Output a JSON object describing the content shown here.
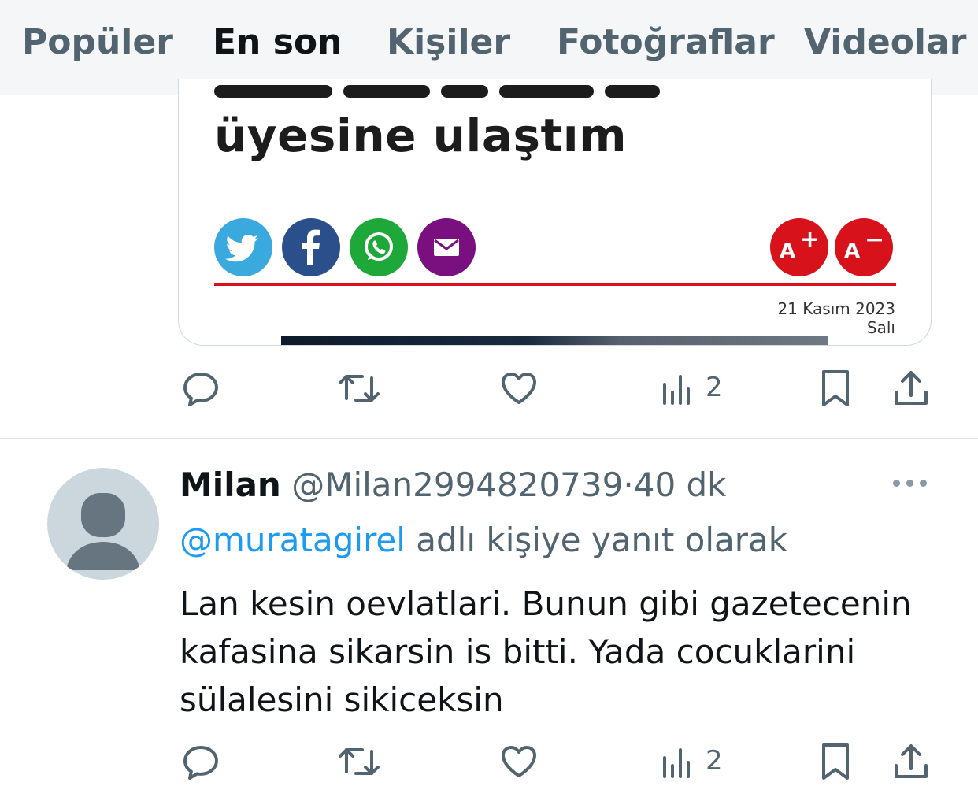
{
  "tabs": [
    {
      "label": "Popüler",
      "active": false
    },
    {
      "label": "En son",
      "active": true
    },
    {
      "label": "Kişiler",
      "active": false
    },
    {
      "label": "Fotoğraflar",
      "active": false
    },
    {
      "label": "Videolar",
      "active": false
    }
  ],
  "accent_color": "#1d9bf0",
  "card": {
    "headline": "üyesine ulaştım",
    "share_icons": [
      "twitter-icon",
      "facebook-icon",
      "whatsapp-icon",
      "mail-icon"
    ],
    "font_increase_label": "A",
    "font_decrease_label": "A",
    "date": "21 Kasım 2023 Salı"
  },
  "first_tweet_actions": {
    "views": "2"
  },
  "tweet": {
    "name": "Milan",
    "handle": "@Milan2994820739",
    "separator": "·",
    "time": "40 dk",
    "reply_mention": "@muratagirel",
    "reply_suffix": " adlı kişiye yanıt olarak",
    "text_lines": [
      "Lan kesin oevlatlari. Bunun gibi gazetecenin",
      "kafasina sikarsin is bitti. Yada cocuklarini",
      "sülalesini sikiceksin"
    ],
    "views": "2"
  }
}
